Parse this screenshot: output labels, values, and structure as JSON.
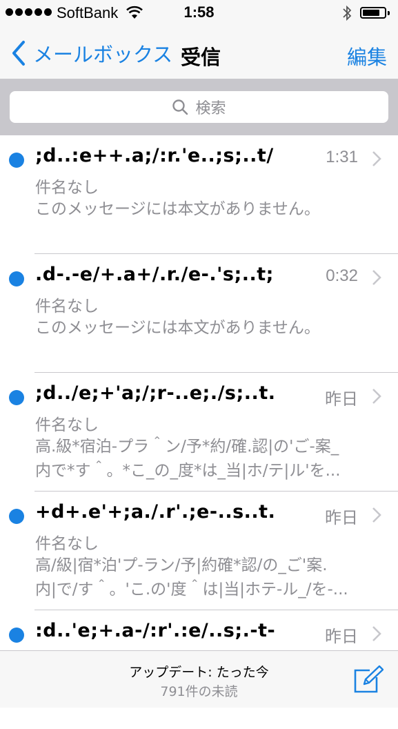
{
  "status_bar": {
    "carrier": "SoftBank",
    "time": "1:58",
    "signal_bars": 5,
    "wifi_icon": "wifi-icon",
    "bluetooth_icon": "bluetooth-icon",
    "battery_level": 0.8
  },
  "nav": {
    "back_label": "メールボックス",
    "title": "受信",
    "edit_label": "編集"
  },
  "search": {
    "placeholder": "検索"
  },
  "messages": [
    {
      "sender": ";d..:e++.a;/:r.'e..;s;..t/",
      "time": "1:31",
      "subject": "件名なし",
      "preview_line1": "このメッセージには本文がありません。",
      "preview_line2": ""
    },
    {
      "sender": ".d-.-e/+.a+/.r./e-.'s;..t;",
      "time": "0:32",
      "subject": "件名なし",
      "preview_line1": "このメッセージには本文がありません。",
      "preview_line2": ""
    },
    {
      "sender": ";d../e;+'a;/;r-..e;./s;..t.",
      "time": "昨日",
      "subject": "件名なし",
      "preview_line1": "高.級*宿泊-プラ＾ン/予*約/確.認|の'ご-案_",
      "preview_line2": "内で*す＾。*こ_の_度*は_当|ホ/テ|ル'を..."
    },
    {
      "sender": "+d+.e'+;a./.r'.;e-..s..t.",
      "time": "昨日",
      "subject": "件名なし",
      "preview_line1": "高/級|宿*泊'プ-ラン/予|約確*認/の_ご'案.",
      "preview_line2": "内|で/す＾。'こ.の'度＾は|当|ホテ-ル_/を-..."
    },
    {
      "sender": ":d..'e;+.a-/:r'.:e/..s;.-t-",
      "time": "昨日",
      "subject": "",
      "preview_line1": "",
      "preview_line2": ""
    }
  ],
  "toolbar": {
    "updated": "アップデート: たった今",
    "unread": "791件の未読",
    "compose_icon": "compose-icon"
  },
  "colors": {
    "accent": "#1a82e2",
    "secondary_text": "#8e8e93",
    "separator": "#c8c7cc"
  }
}
